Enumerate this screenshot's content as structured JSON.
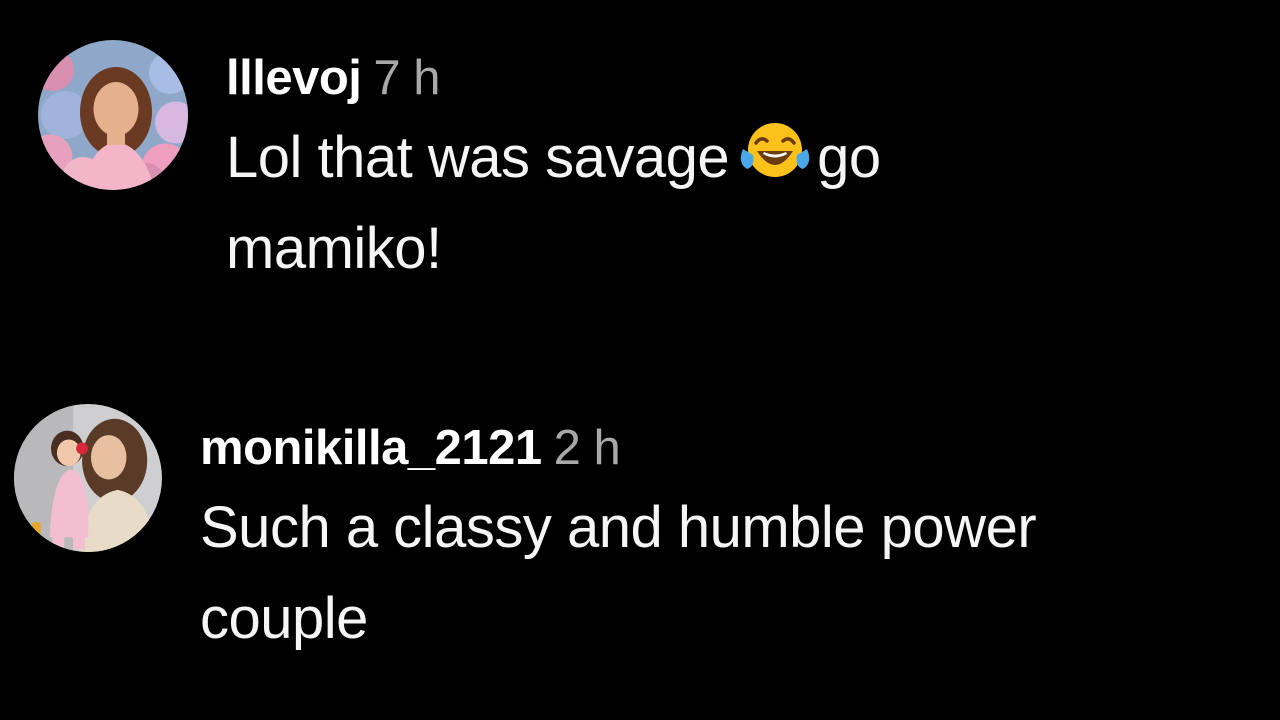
{
  "comments": [
    {
      "username": "lllevoj",
      "time": "7 h",
      "text_line1_before_emoji": "Lol that was savage",
      "emoji": "face-with-tears-of-joy",
      "text_line1_after_emoji": "go",
      "text_line2": "mamiko!",
      "avatar_icon": "avatar-hydrangea-portrait"
    },
    {
      "username": "monikilla_2121",
      "time": "2 h",
      "text_line1": "Such a classy and humble power",
      "text_line2": "couple",
      "avatar_icon": "avatar-mother-child-portrait"
    }
  ],
  "colors": {
    "background": "#000000",
    "username": "#ffffff",
    "timestamp": "#a8a8a8",
    "text": "#f5f5f5"
  }
}
